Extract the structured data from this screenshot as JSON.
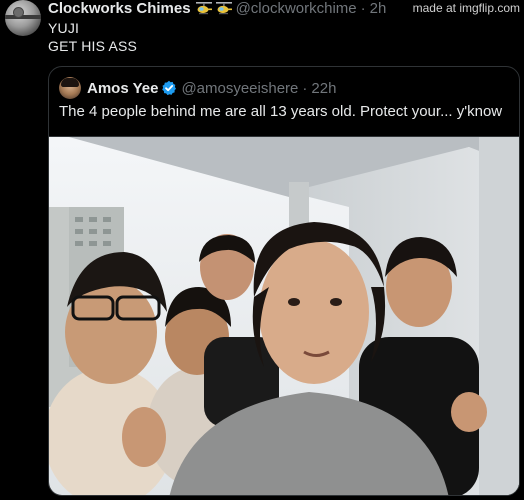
{
  "tweet": {
    "display_name": "Clockworks Chimes",
    "handle": "@clockworkchime",
    "separator": "·",
    "time": "2h",
    "lines": [
      "YUJI",
      "GET HIS ASS"
    ],
    "badges": [
      "helicopter-emoji",
      "helicopter-emoji"
    ]
  },
  "watermark": "made at imgflip.com",
  "quote": {
    "display_name": "Amos Yee",
    "handle": "@amosyeeishere",
    "separator": "·",
    "time": "22h",
    "text": "The 4 people behind me are all 13 years old. Protect your... y'know",
    "verified_color": "#1d9bf0"
  },
  "photo": {
    "description_icon": "group-selfie-photo"
  }
}
